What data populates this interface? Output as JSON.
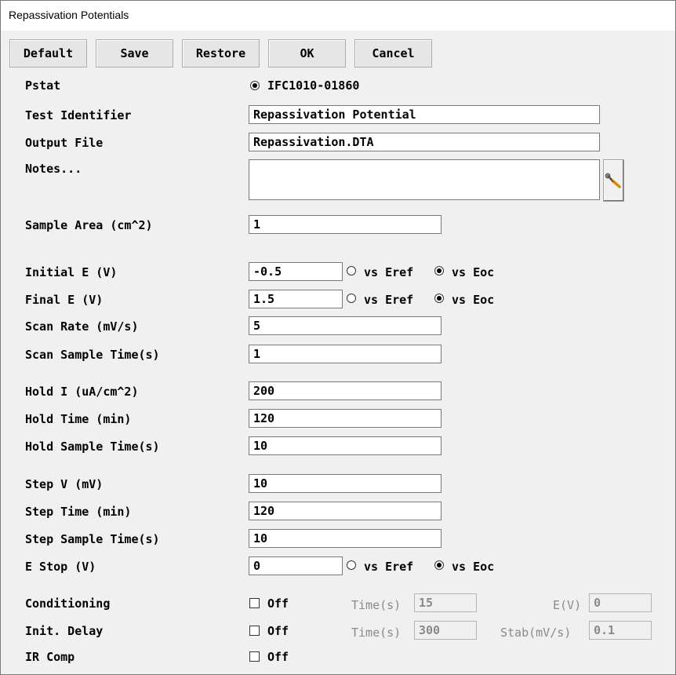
{
  "window": {
    "title": "Repassivation Potentials"
  },
  "toolbar": {
    "default_label": "Default",
    "save_label": "Save",
    "restore_label": "Restore",
    "ok_label": "OK",
    "cancel_label": "Cancel"
  },
  "pstat": {
    "label": "Pstat",
    "value": "IFC1010-01860"
  },
  "test_identifier": {
    "label": "Test Identifier",
    "value": "Repassivation Potential"
  },
  "output_file": {
    "label": "Output File",
    "value": "Repassivation.DTA"
  },
  "notes": {
    "label": "Notes...",
    "value": "",
    "edit_icon": "wrench-screwdriver-icon"
  },
  "sample_area": {
    "label": "Sample Area (cm^2)",
    "value": "1"
  },
  "initial_e": {
    "label": "Initial E (V)",
    "value": "-0.5",
    "opt_eref": "vs Eref",
    "opt_eoc": "vs Eoc",
    "selected": "vs Eoc"
  },
  "final_e": {
    "label": "Final E (V)",
    "value": "1.5",
    "opt_eref": "vs Eref",
    "opt_eoc": "vs Eoc",
    "selected": "vs Eoc"
  },
  "scan_rate": {
    "label": "Scan Rate (mV/s)",
    "value": "5"
  },
  "scan_sample_time": {
    "label": "Scan Sample Time(s)",
    "value": "1"
  },
  "hold_i": {
    "label": "Hold I (uA/cm^2)",
    "value": "200"
  },
  "hold_time": {
    "label": "Hold Time (min)",
    "value": "120"
  },
  "hold_sample_time": {
    "label": "Hold Sample Time(s)",
    "value": "10"
  },
  "step_v": {
    "label": "Step V (mV)",
    "value": "10"
  },
  "step_time": {
    "label": "Step Time (min)",
    "value": "120"
  },
  "step_sample_time": {
    "label": "Step Sample Time(s)",
    "value": "10"
  },
  "e_stop": {
    "label": "E Stop (V)",
    "value": "0",
    "opt_eref": "vs Eref",
    "opt_eoc": "vs Eoc",
    "selected": "vs Eoc"
  },
  "conditioning": {
    "label": "Conditioning",
    "state": "Off",
    "time_label": "Time(s)",
    "time_value": "15",
    "e_label": "E(V)",
    "e_value": "0"
  },
  "init_delay": {
    "label": "Init. Delay",
    "state": "Off",
    "time_label": "Time(s)",
    "time_value": "300",
    "stab_label": "Stab(mV/s)",
    "stab_value": "0.1"
  },
  "ir_comp": {
    "label": "IR Comp",
    "state": "Off"
  }
}
